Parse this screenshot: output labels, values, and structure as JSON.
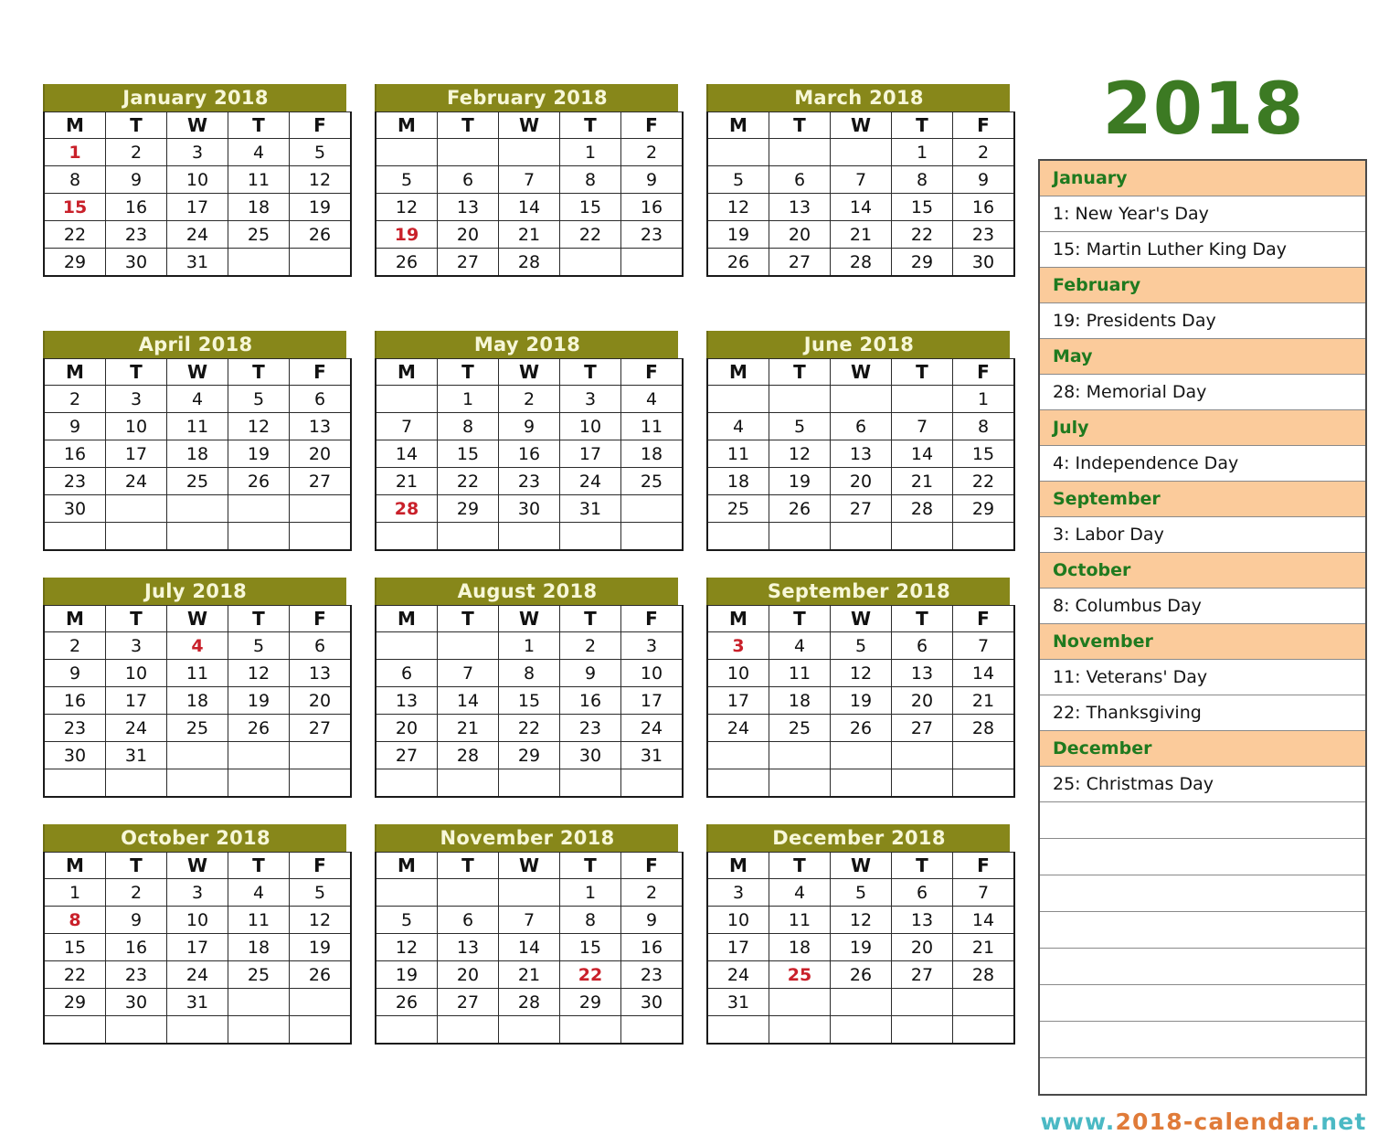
{
  "year_title": "2018",
  "site_url": {
    "prefix": "www.",
    "middle": "2018-calendar",
    "suffix": ".net"
  },
  "colors": {
    "month_header_bg": "#87871A",
    "month_header_text": "#F7F7D8",
    "holiday_day": "#C9202A",
    "panel_month_bg": "#FBCB9B",
    "panel_month_text": "#1F7A1F",
    "year_text": "#3C7A23",
    "url_teal": "#4BB9C4",
    "url_orange": "#E07B39"
  },
  "weekday_headers": [
    "M",
    "T",
    "W",
    "T",
    "F"
  ],
  "months": [
    {
      "title": "January 2018",
      "weeks": [
        [
          "1",
          "2",
          "3",
          "4",
          "5"
        ],
        [
          "8",
          "9",
          "10",
          "11",
          "12"
        ],
        [
          "15",
          "16",
          "17",
          "18",
          "19"
        ],
        [
          "22",
          "23",
          "24",
          "25",
          "26"
        ],
        [
          "29",
          "30",
          "31",
          "",
          ""
        ]
      ],
      "highlight": [
        "1",
        "15"
      ]
    },
    {
      "title": "February 2018",
      "weeks": [
        [
          "",
          "",
          "",
          "1",
          "2"
        ],
        [
          "5",
          "6",
          "7",
          "8",
          "9"
        ],
        [
          "12",
          "13",
          "14",
          "15",
          "16"
        ],
        [
          "19",
          "20",
          "21",
          "22",
          "23"
        ],
        [
          "26",
          "27",
          "28",
          "",
          ""
        ]
      ],
      "highlight": [
        "19"
      ]
    },
    {
      "title": "March 2018",
      "weeks": [
        [
          "",
          "",
          "",
          "1",
          "2"
        ],
        [
          "5",
          "6",
          "7",
          "8",
          "9"
        ],
        [
          "12",
          "13",
          "14",
          "15",
          "16"
        ],
        [
          "19",
          "20",
          "21",
          "22",
          "23"
        ],
        [
          "26",
          "27",
          "28",
          "29",
          "30"
        ]
      ],
      "highlight": []
    },
    {
      "title": "April 2018",
      "weeks": [
        [
          "2",
          "3",
          "4",
          "5",
          "6"
        ],
        [
          "9",
          "10",
          "11",
          "12",
          "13"
        ],
        [
          "16",
          "17",
          "18",
          "19",
          "20"
        ],
        [
          "23",
          "24",
          "25",
          "26",
          "27"
        ],
        [
          "30",
          "",
          "",
          "",
          ""
        ],
        [
          "",
          "",
          "",
          "",
          ""
        ]
      ],
      "highlight": []
    },
    {
      "title": "May 2018",
      "weeks": [
        [
          "",
          "1",
          "2",
          "3",
          "4"
        ],
        [
          "7",
          "8",
          "9",
          "10",
          "11"
        ],
        [
          "14",
          "15",
          "16",
          "17",
          "18"
        ],
        [
          "21",
          "22",
          "23",
          "24",
          "25"
        ],
        [
          "28",
          "29",
          "30",
          "31",
          ""
        ],
        [
          "",
          "",
          "",
          "",
          ""
        ]
      ],
      "highlight": [
        "28"
      ]
    },
    {
      "title": "June 2018",
      "weeks": [
        [
          "",
          "",
          "",
          "",
          "1"
        ],
        [
          "4",
          "5",
          "6",
          "7",
          "8"
        ],
        [
          "11",
          "12",
          "13",
          "14",
          "15"
        ],
        [
          "18",
          "19",
          "20",
          "21",
          "22"
        ],
        [
          "25",
          "26",
          "27",
          "28",
          "29"
        ],
        [
          "",
          "",
          "",
          "",
          ""
        ]
      ],
      "highlight": []
    },
    {
      "title": "July 2018",
      "weeks": [
        [
          "2",
          "3",
          "4",
          "5",
          "6"
        ],
        [
          "9",
          "10",
          "11",
          "12",
          "13"
        ],
        [
          "16",
          "17",
          "18",
          "19",
          "20"
        ],
        [
          "23",
          "24",
          "25",
          "26",
          "27"
        ],
        [
          "30",
          "31",
          "",
          "",
          ""
        ],
        [
          "",
          "",
          "",
          "",
          ""
        ]
      ],
      "highlight": [
        "4"
      ]
    },
    {
      "title": "August 2018",
      "weeks": [
        [
          "",
          "",
          "1",
          "2",
          "3"
        ],
        [
          "6",
          "7",
          "8",
          "9",
          "10"
        ],
        [
          "13",
          "14",
          "15",
          "16",
          "17"
        ],
        [
          "20",
          "21",
          "22",
          "23",
          "24"
        ],
        [
          "27",
          "28",
          "29",
          "30",
          "31"
        ],
        [
          "",
          "",
          "",
          "",
          ""
        ]
      ],
      "highlight": []
    },
    {
      "title": "September 2018",
      "weeks": [
        [
          "3",
          "4",
          "5",
          "6",
          "7"
        ],
        [
          "10",
          "11",
          "12",
          "13",
          "14"
        ],
        [
          "17",
          "18",
          "19",
          "20",
          "21"
        ],
        [
          "24",
          "25",
          "26",
          "27",
          "28"
        ],
        [
          "",
          "",
          "",
          "",
          ""
        ],
        [
          "",
          "",
          "",
          "",
          ""
        ]
      ],
      "highlight": [
        "3"
      ]
    },
    {
      "title": "October 2018",
      "weeks": [
        [
          "1",
          "2",
          "3",
          "4",
          "5"
        ],
        [
          "8",
          "9",
          "10",
          "11",
          "12"
        ],
        [
          "15",
          "16",
          "17",
          "18",
          "19"
        ],
        [
          "22",
          "23",
          "24",
          "25",
          "26"
        ],
        [
          "29",
          "30",
          "31",
          "",
          ""
        ],
        [
          "",
          "",
          "",
          "",
          ""
        ]
      ],
      "highlight": [
        "8"
      ]
    },
    {
      "title": "November 2018",
      "weeks": [
        [
          "",
          "",
          "",
          "1",
          "2"
        ],
        [
          "5",
          "6",
          "7",
          "8",
          "9"
        ],
        [
          "12",
          "13",
          "14",
          "15",
          "16"
        ],
        [
          "19",
          "20",
          "21",
          "22",
          "23"
        ],
        [
          "26",
          "27",
          "28",
          "29",
          "30"
        ],
        [
          "",
          "",
          "",
          "",
          ""
        ]
      ],
      "highlight": [
        "22"
      ]
    },
    {
      "title": "December 2018",
      "weeks": [
        [
          "3",
          "4",
          "5",
          "6",
          "7"
        ],
        [
          "10",
          "11",
          "12",
          "13",
          "14"
        ],
        [
          "17",
          "18",
          "19",
          "20",
          "21"
        ],
        [
          "24",
          "25",
          "26",
          "27",
          "28"
        ],
        [
          "31",
          "",
          "",
          "",
          ""
        ],
        [
          "",
          "",
          "",
          "",
          ""
        ]
      ],
      "highlight": [
        "25"
      ]
    }
  ],
  "holiday_list": [
    {
      "type": "month",
      "text": "January"
    },
    {
      "type": "holiday",
      "text": "1: New Year's Day"
    },
    {
      "type": "holiday",
      "text": "15: Martin Luther King Day"
    },
    {
      "type": "month",
      "text": "February"
    },
    {
      "type": "holiday",
      "text": "19: Presidents Day"
    },
    {
      "type": "month",
      "text": "May"
    },
    {
      "type": "holiday",
      "text": "28: Memorial Day"
    },
    {
      "type": "month",
      "text": "July"
    },
    {
      "type": "holiday",
      "text": "4: Independence Day"
    },
    {
      "type": "month",
      "text": "September"
    },
    {
      "type": "holiday",
      "text": "3: Labor Day"
    },
    {
      "type": "month",
      "text": "October"
    },
    {
      "type": "holiday",
      "text": "8: Columbus Day"
    },
    {
      "type": "month",
      "text": "November"
    },
    {
      "type": "holiday",
      "text": "11: Veterans' Day"
    },
    {
      "type": "holiday",
      "text": "22: Thanksgiving"
    },
    {
      "type": "month",
      "text": "December"
    },
    {
      "type": "holiday",
      "text": "25: Christmas Day"
    },
    {
      "type": "blank",
      "text": ""
    },
    {
      "type": "blank",
      "text": ""
    },
    {
      "type": "blank",
      "text": ""
    },
    {
      "type": "blank",
      "text": ""
    },
    {
      "type": "blank",
      "text": ""
    },
    {
      "type": "blank",
      "text": ""
    },
    {
      "type": "blank",
      "text": ""
    },
    {
      "type": "blank",
      "text": ""
    }
  ]
}
